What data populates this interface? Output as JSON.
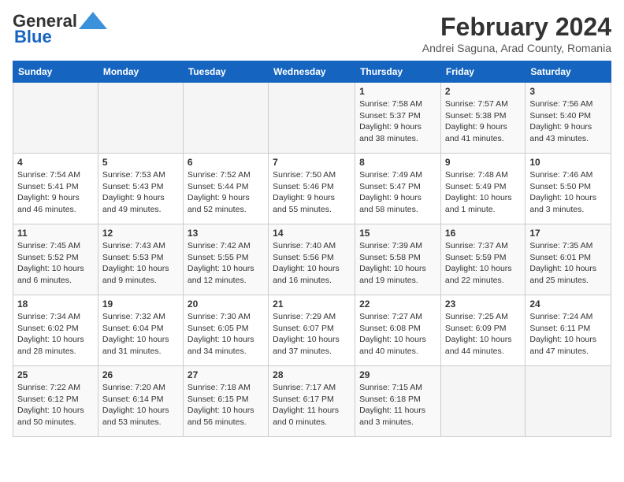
{
  "header": {
    "logo_general": "General",
    "logo_blue": "Blue",
    "month_title": "February 2024",
    "subtitle": "Andrei Saguna, Arad County, Romania"
  },
  "days_of_week": [
    "Sunday",
    "Monday",
    "Tuesday",
    "Wednesday",
    "Thursday",
    "Friday",
    "Saturday"
  ],
  "weeks": [
    [
      {
        "day": "",
        "info": ""
      },
      {
        "day": "",
        "info": ""
      },
      {
        "day": "",
        "info": ""
      },
      {
        "day": "",
        "info": ""
      },
      {
        "day": "1",
        "info": "Sunrise: 7:58 AM\nSunset: 5:37 PM\nDaylight: 9 hours\nand 38 minutes."
      },
      {
        "day": "2",
        "info": "Sunrise: 7:57 AM\nSunset: 5:38 PM\nDaylight: 9 hours\nand 41 minutes."
      },
      {
        "day": "3",
        "info": "Sunrise: 7:56 AM\nSunset: 5:40 PM\nDaylight: 9 hours\nand 43 minutes."
      }
    ],
    [
      {
        "day": "4",
        "info": "Sunrise: 7:54 AM\nSunset: 5:41 PM\nDaylight: 9 hours\nand 46 minutes."
      },
      {
        "day": "5",
        "info": "Sunrise: 7:53 AM\nSunset: 5:43 PM\nDaylight: 9 hours\nand 49 minutes."
      },
      {
        "day": "6",
        "info": "Sunrise: 7:52 AM\nSunset: 5:44 PM\nDaylight: 9 hours\nand 52 minutes."
      },
      {
        "day": "7",
        "info": "Sunrise: 7:50 AM\nSunset: 5:46 PM\nDaylight: 9 hours\nand 55 minutes."
      },
      {
        "day": "8",
        "info": "Sunrise: 7:49 AM\nSunset: 5:47 PM\nDaylight: 9 hours\nand 58 minutes."
      },
      {
        "day": "9",
        "info": "Sunrise: 7:48 AM\nSunset: 5:49 PM\nDaylight: 10 hours\nand 1 minute."
      },
      {
        "day": "10",
        "info": "Sunrise: 7:46 AM\nSunset: 5:50 PM\nDaylight: 10 hours\nand 3 minutes."
      }
    ],
    [
      {
        "day": "11",
        "info": "Sunrise: 7:45 AM\nSunset: 5:52 PM\nDaylight: 10 hours\nand 6 minutes."
      },
      {
        "day": "12",
        "info": "Sunrise: 7:43 AM\nSunset: 5:53 PM\nDaylight: 10 hours\nand 9 minutes."
      },
      {
        "day": "13",
        "info": "Sunrise: 7:42 AM\nSunset: 5:55 PM\nDaylight: 10 hours\nand 12 minutes."
      },
      {
        "day": "14",
        "info": "Sunrise: 7:40 AM\nSunset: 5:56 PM\nDaylight: 10 hours\nand 16 minutes."
      },
      {
        "day": "15",
        "info": "Sunrise: 7:39 AM\nSunset: 5:58 PM\nDaylight: 10 hours\nand 19 minutes."
      },
      {
        "day": "16",
        "info": "Sunrise: 7:37 AM\nSunset: 5:59 PM\nDaylight: 10 hours\nand 22 minutes."
      },
      {
        "day": "17",
        "info": "Sunrise: 7:35 AM\nSunset: 6:01 PM\nDaylight: 10 hours\nand 25 minutes."
      }
    ],
    [
      {
        "day": "18",
        "info": "Sunrise: 7:34 AM\nSunset: 6:02 PM\nDaylight: 10 hours\nand 28 minutes."
      },
      {
        "day": "19",
        "info": "Sunrise: 7:32 AM\nSunset: 6:04 PM\nDaylight: 10 hours\nand 31 minutes."
      },
      {
        "day": "20",
        "info": "Sunrise: 7:30 AM\nSunset: 6:05 PM\nDaylight: 10 hours\nand 34 minutes."
      },
      {
        "day": "21",
        "info": "Sunrise: 7:29 AM\nSunset: 6:07 PM\nDaylight: 10 hours\nand 37 minutes."
      },
      {
        "day": "22",
        "info": "Sunrise: 7:27 AM\nSunset: 6:08 PM\nDaylight: 10 hours\nand 40 minutes."
      },
      {
        "day": "23",
        "info": "Sunrise: 7:25 AM\nSunset: 6:09 PM\nDaylight: 10 hours\nand 44 minutes."
      },
      {
        "day": "24",
        "info": "Sunrise: 7:24 AM\nSunset: 6:11 PM\nDaylight: 10 hours\nand 47 minutes."
      }
    ],
    [
      {
        "day": "25",
        "info": "Sunrise: 7:22 AM\nSunset: 6:12 PM\nDaylight: 10 hours\nand 50 minutes."
      },
      {
        "day": "26",
        "info": "Sunrise: 7:20 AM\nSunset: 6:14 PM\nDaylight: 10 hours\nand 53 minutes."
      },
      {
        "day": "27",
        "info": "Sunrise: 7:18 AM\nSunset: 6:15 PM\nDaylight: 10 hours\nand 56 minutes."
      },
      {
        "day": "28",
        "info": "Sunrise: 7:17 AM\nSunset: 6:17 PM\nDaylight: 11 hours\nand 0 minutes."
      },
      {
        "day": "29",
        "info": "Sunrise: 7:15 AM\nSunset: 6:18 PM\nDaylight: 11 hours\nand 3 minutes."
      },
      {
        "day": "",
        "info": ""
      },
      {
        "day": "",
        "info": ""
      }
    ]
  ]
}
